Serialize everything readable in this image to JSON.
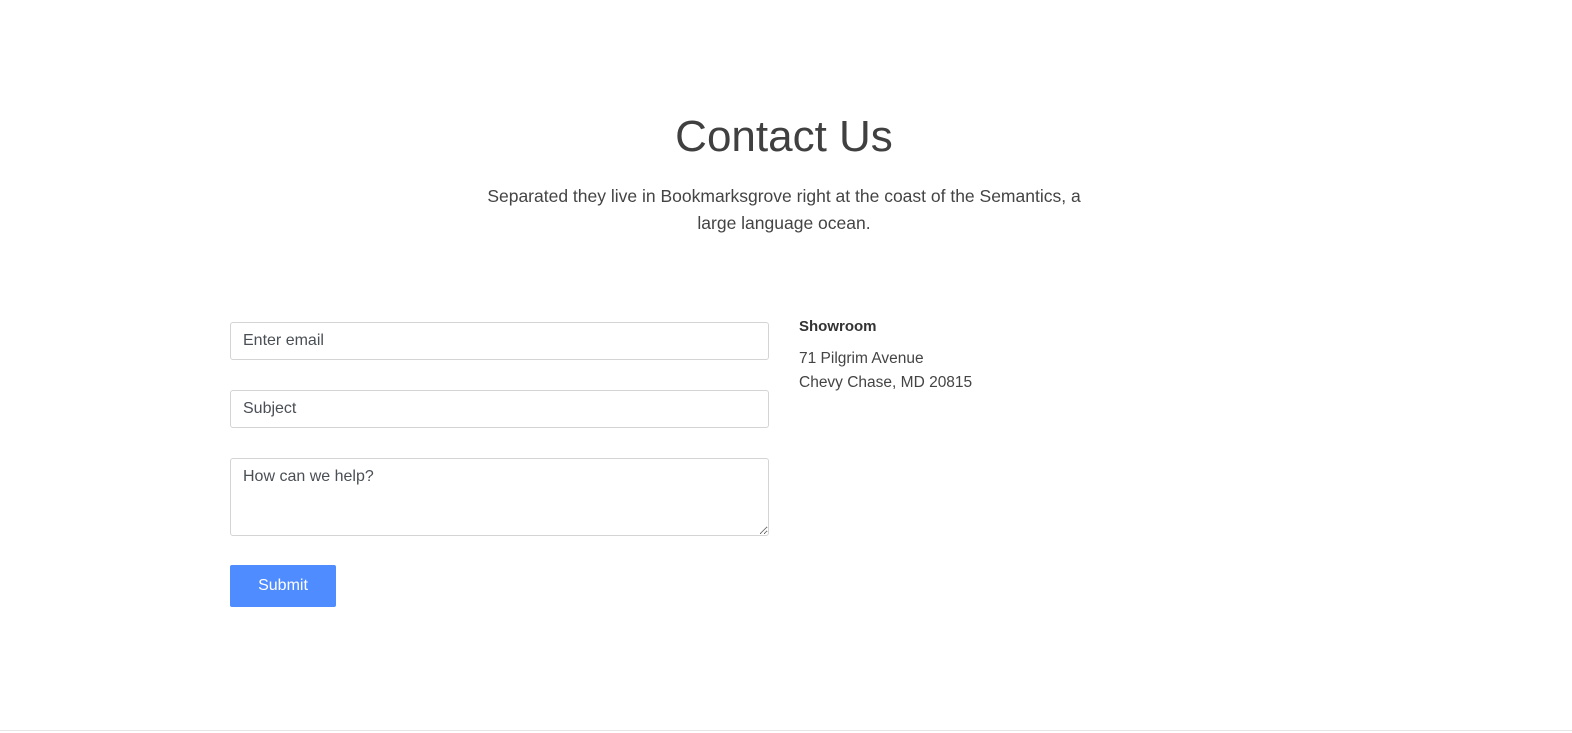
{
  "header": {
    "title": "Contact Us",
    "subtitle": "Separated they live in Bookmarksgrove right at the coast of the Semantics, a large language ocean."
  },
  "form": {
    "email_placeholder": "Enter email",
    "email_value": "",
    "subject_placeholder": "Subject",
    "subject_value": "",
    "message_placeholder": "How can we help?",
    "message_value": "",
    "submit_label": "Submit"
  },
  "showroom": {
    "heading": "Showroom",
    "address_line1": "71 Pilgrim Avenue",
    "address_line2": "Chevy Chase, MD 20815"
  },
  "colors": {
    "accent": "#4f8cff",
    "text": "#444444"
  }
}
